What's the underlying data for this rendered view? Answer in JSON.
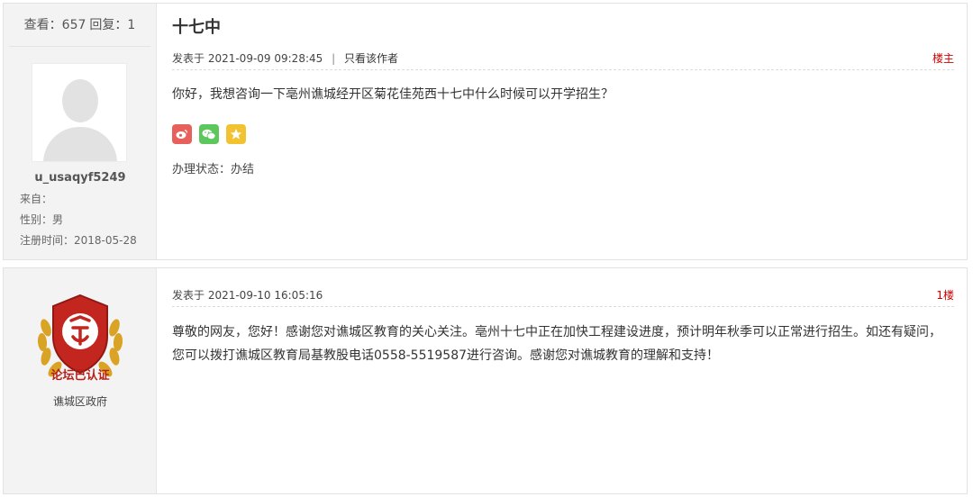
{
  "post1": {
    "stats": {
      "views_label": "查看：",
      "views": "657",
      "replies_label": "回复：",
      "replies": "1"
    },
    "user": {
      "username": "u_usaqyf5249",
      "from": "来自：",
      "gender": "性别：男",
      "registered": "注册时间：2018-05-28"
    },
    "title": "十七中",
    "posted_at": "发表于 2021-09-09 09:28:45",
    "divider": "|",
    "author_only": "只看该作者",
    "floor": "楼主",
    "content": "你好，我想咨询一下亳州谯城经开区菊花佳苑西十七中什么时候可以开学招生？",
    "status": "办理状态：办结",
    "share_icons": [
      "weibo-icon",
      "wechat-icon",
      "favorite-star-icon"
    ],
    "colors": {
      "floor": "#cc0000",
      "weibo": "#e8605c",
      "wechat": "#5cc75c",
      "star": "#f2c230"
    }
  },
  "post2": {
    "badge_text": "论坛已认证",
    "org": "谯城区政府",
    "posted_at": "发表于 2021-09-10 16:05:16",
    "floor": "1楼",
    "content": "尊敬的网友，您好！感谢您对谯城区教育的关心关注。亳州十七中正在加快工程建设进度，预计明年秋季可以正常进行招生。如还有疑问，您可以拨打谯城区教育局基教股电话0558-5519587进行咨询。感谢您对谯城教育的理解和支持！"
  }
}
